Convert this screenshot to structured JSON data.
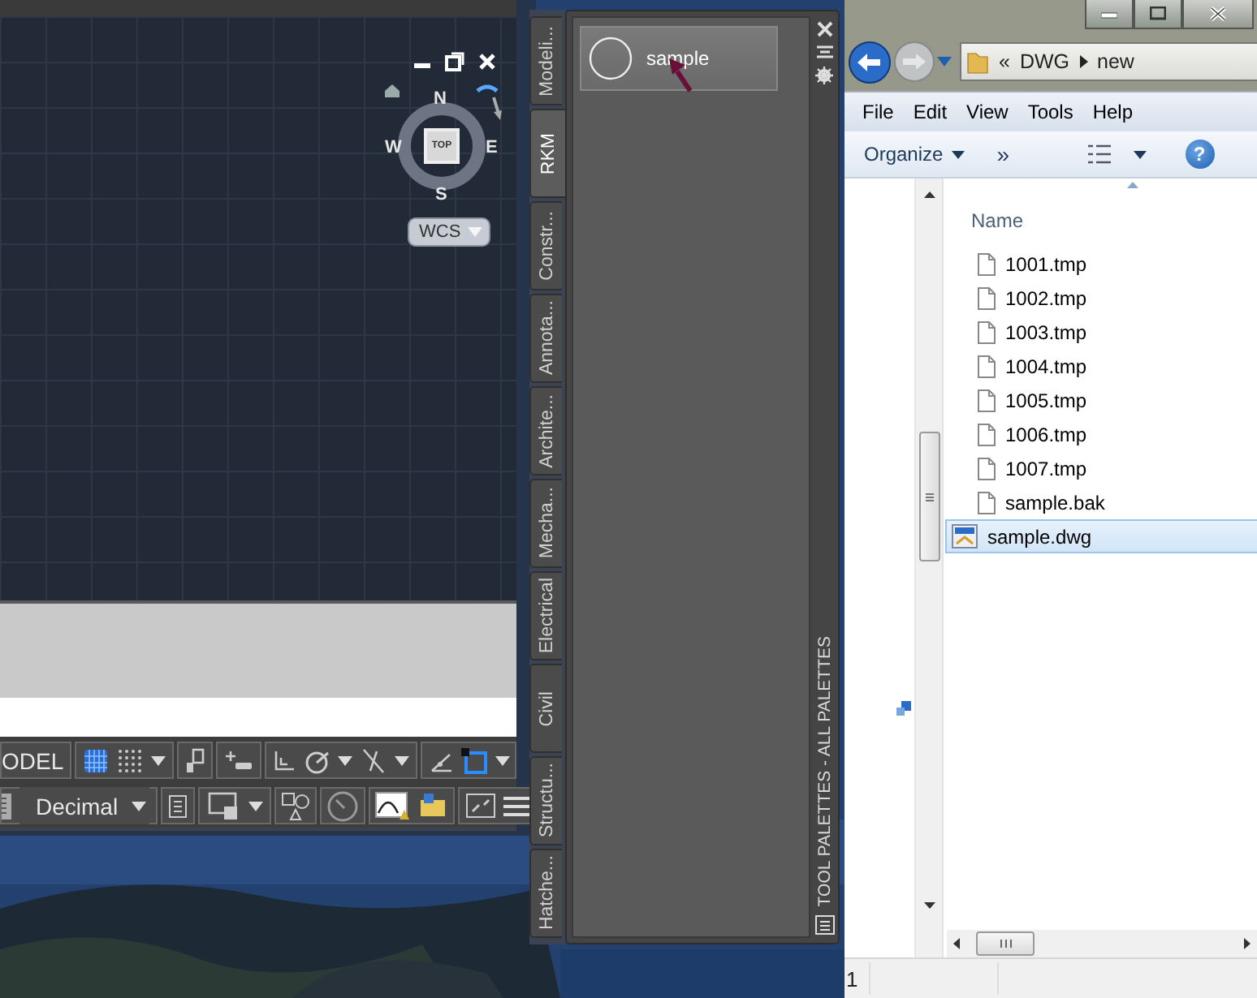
{
  "cad": {
    "viewcube": {
      "face": "TOP",
      "north": "N",
      "south": "S",
      "east": "E",
      "west": "W"
    },
    "coordinate_system": "WCS",
    "status_bar": {
      "space": "ODEL",
      "units": "Decimal"
    }
  },
  "palette": {
    "tabs": [
      {
        "label": "Modeli...",
        "selected": false
      },
      {
        "label": "RKM",
        "selected": true
      },
      {
        "label": "Constr...",
        "selected": false
      },
      {
        "label": "Annota...",
        "selected": false
      },
      {
        "label": "Archite...",
        "selected": false
      },
      {
        "label": "Mecha...",
        "selected": false
      },
      {
        "label": "Electrical",
        "selected": false
      },
      {
        "label": "Civil",
        "selected": false
      },
      {
        "label": "Structu...",
        "selected": false
      },
      {
        "label": "Hatche...",
        "selected": false
      }
    ],
    "tools": [
      {
        "label": "sample"
      }
    ],
    "title": "TOOL PALETTES - ALL PALETTES"
  },
  "explorer": {
    "breadcrumb": {
      "overflow": "«",
      "path": [
        "DWG",
        "new"
      ]
    },
    "menu": [
      "File",
      "Edit",
      "View",
      "Tools",
      "Help"
    ],
    "toolbar": {
      "organize": "Organize",
      "more": "»",
      "help": "?"
    },
    "column": "Name",
    "files": [
      {
        "name": "1001.tmp",
        "kind": "file",
        "selected": false
      },
      {
        "name": "1002.tmp",
        "kind": "file",
        "selected": false
      },
      {
        "name": "1003.tmp",
        "kind": "file",
        "selected": false
      },
      {
        "name": "1004.tmp",
        "kind": "file",
        "selected": false
      },
      {
        "name": "1005.tmp",
        "kind": "file",
        "selected": false
      },
      {
        "name": "1006.tmp",
        "kind": "file",
        "selected": false
      },
      {
        "name": "1007.tmp",
        "kind": "file",
        "selected": false
      },
      {
        "name": "sample.bak",
        "kind": "file",
        "selected": false
      },
      {
        "name": "sample.dwg",
        "kind": "drawing",
        "selected": true
      }
    ],
    "status": "1"
  }
}
